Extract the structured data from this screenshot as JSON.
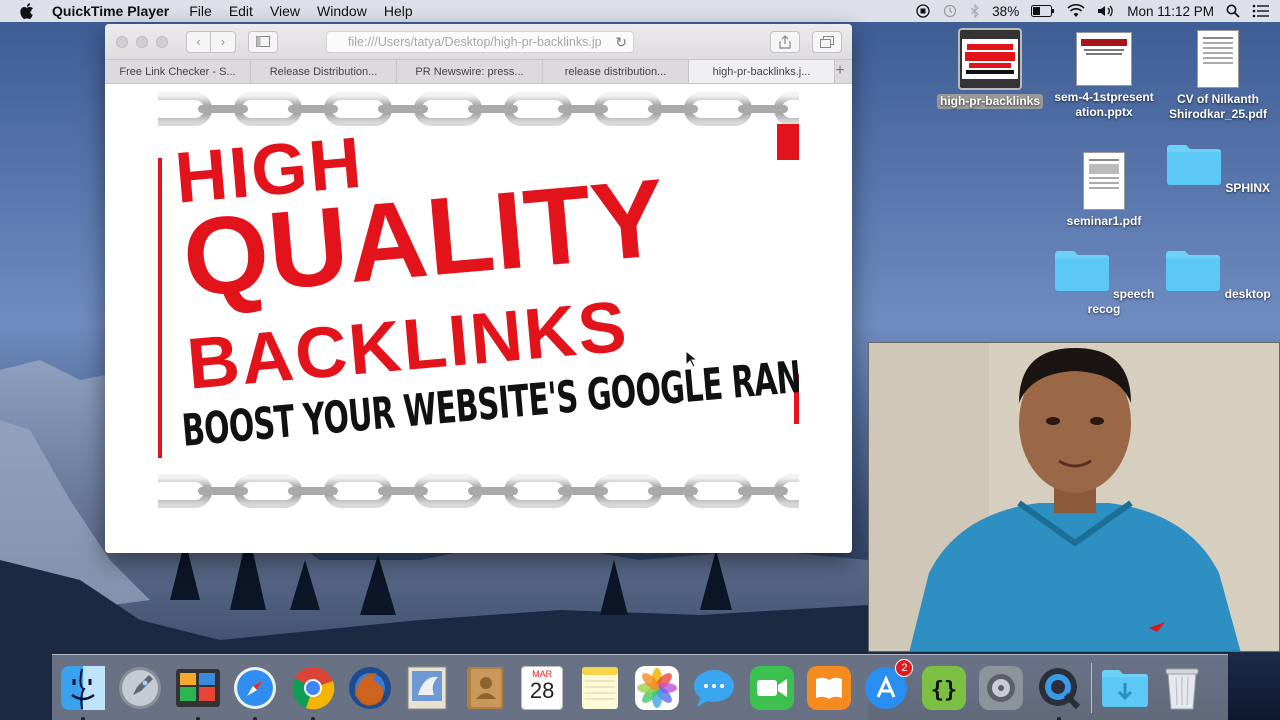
{
  "menubar": {
    "app_name": "QuickTime Player",
    "menus": [
      "File",
      "Edit",
      "View",
      "Window",
      "Help"
    ],
    "battery": "38%",
    "clock": "Mon 11:12 PM"
  },
  "browser": {
    "url": "file:///Users/tatya/Desktop/high-pr-backlinks.jp",
    "tabs": [
      {
        "label": "Free Link Checker - S..."
      },
      {
        "label": "Release Distribution..."
      },
      {
        "label": "PR Newswire: press..."
      },
      {
        "label": "release distribution..."
      },
      {
        "label": "high-pr-backlinks.j..."
      }
    ],
    "active_tab": 4
  },
  "banner": {
    "line1": "HIGH",
    "line2": "QUALITY",
    "line3": "BACKLINKS",
    "line4": "BOOST YOUR WEBSITE'S GOOGLE RANKING!"
  },
  "desktop": {
    "icons": [
      {
        "label": "high-pr-backlinks",
        "type": "image"
      },
      {
        "label": "sem-4-1stpresent ation.pptx",
        "type": "pptx"
      },
      {
        "label": "CV of Nilkanth Shirodkar_25.pdf",
        "type": "pdf"
      },
      {
        "label": "seminar1.pdf",
        "type": "pdf"
      },
      {
        "label": "SPHINX",
        "type": "folder"
      },
      {
        "label": "speech recog",
        "type": "folder"
      },
      {
        "label": "desktop",
        "type": "folder"
      }
    ]
  },
  "dock": {
    "items": [
      "finder-icon",
      "launchpad-icon",
      "image-capture-icon",
      "safari-icon",
      "chrome-icon",
      "firefox-icon",
      "mail-icon",
      "contacts-icon",
      "calendar-icon",
      "notes-icon",
      "photos-icon",
      "messages-icon",
      "facetime-icon",
      "ibooks-icon",
      "app-store-icon",
      "brackets-icon",
      "system-preferences-icon",
      "quicktime-icon",
      "downloads-icon",
      "trash-icon"
    ],
    "calendar_month": "MAR",
    "calendar_day": "28",
    "app_store_badge": "2"
  },
  "colors": {
    "banner_red": "#e2131b",
    "menubar_bg": "#ebebf0",
    "folder_blue": "#5bc8f5"
  }
}
